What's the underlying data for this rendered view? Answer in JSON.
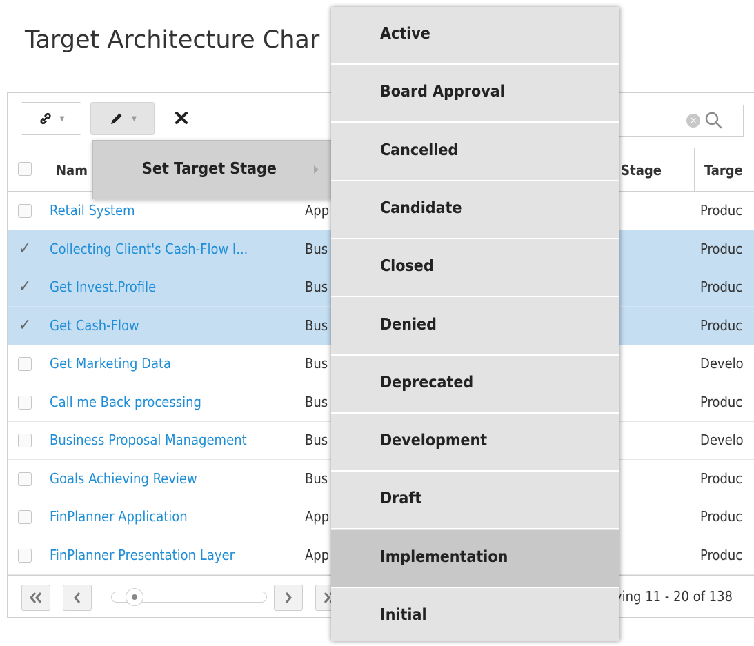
{
  "page": {
    "title": "Target Architecture Char"
  },
  "toolbar": {
    "link_icon": "link-icon",
    "edit_icon": "pencil-icon",
    "delete_icon": "close-icon"
  },
  "search": {
    "clear_icon": "clear-icon",
    "search_icon": "search-icon"
  },
  "table": {
    "headers": {
      "name": "Nam",
      "planned_stage": "d Stage",
      "target_stage": "Targe"
    },
    "rows": [
      {
        "name": "Retail System",
        "type": "App",
        "stage": "Produc",
        "selected": false
      },
      {
        "name": "Collecting Client's Cash-Flow I...",
        "type": "Bus",
        "stage": "Produc",
        "selected": true
      },
      {
        "name": "Get Invest.Profile",
        "type": "Bus",
        "stage": "Produc",
        "selected": true
      },
      {
        "name": "Get Cash-Flow",
        "type": "Bus",
        "stage": "Produc",
        "selected": true
      },
      {
        "name": "Get Marketing Data",
        "type": "Bus",
        "stage": "Develo",
        "selected": false
      },
      {
        "name": "Call me Back processing",
        "type": "Bus",
        "stage": "Produc",
        "selected": false
      },
      {
        "name": "Business Proposal Management",
        "type": "Bus",
        "stage": "Develo",
        "selected": false
      },
      {
        "name": "Goals Achieving Review",
        "type": "Bus",
        "stage": "Produc",
        "selected": false
      },
      {
        "name": "FinPlanner Application",
        "type": "App",
        "stage": "Produc",
        "selected": false
      },
      {
        "name": "FinPlanner Presentation Layer",
        "type": "App",
        "stage": "Produc",
        "selected": false
      }
    ]
  },
  "pager": {
    "info": "ying 11 - 20 of 138"
  },
  "context_menu": {
    "label": "Set Target Stage"
  },
  "stage_menu": {
    "items": [
      "Active",
      "Board Approval",
      "Cancelled",
      "Candidate",
      "Closed",
      "Denied",
      "Deprecated",
      "Development",
      "Draft",
      "Implementation",
      "Initial"
    ],
    "highlighted": "Implementation"
  },
  "colors": {
    "link": "#1f8ed6",
    "selected_row": "#c5def2",
    "menu_bg": "#e3e3e3",
    "menu_highlight": "#c8c8c8"
  }
}
